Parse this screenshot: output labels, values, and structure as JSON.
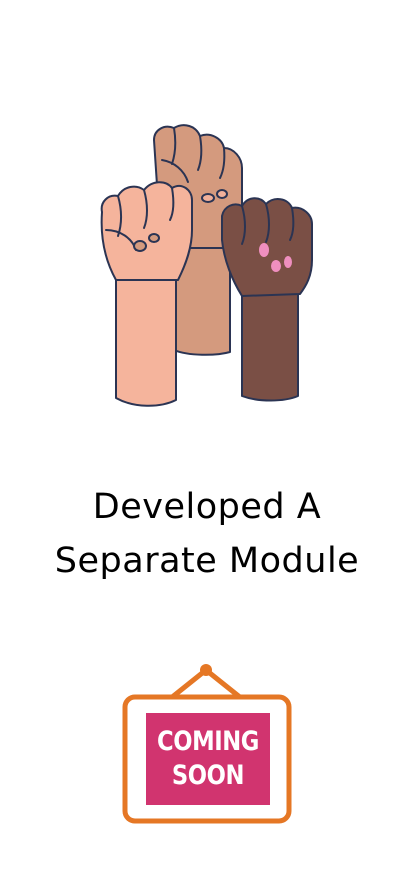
{
  "illustration": {
    "icon": "raised-fists-icon",
    "colors": {
      "outline": "#2b3453",
      "skin_light": "#f5b49c",
      "skin_medium": "#d49a7e",
      "skin_dark": "#7a4f45",
      "nail_pink": "#ef8fbf"
    }
  },
  "headline": {
    "line1": "Developed A",
    "line2": "Separate Module"
  },
  "coming_soon": {
    "icon": "coming-soon-sign-icon",
    "line1": "COMING",
    "line2": "SOON",
    "colors": {
      "frame": "#e57725",
      "panel": "#d1346f",
      "text": "#ffffff"
    }
  }
}
